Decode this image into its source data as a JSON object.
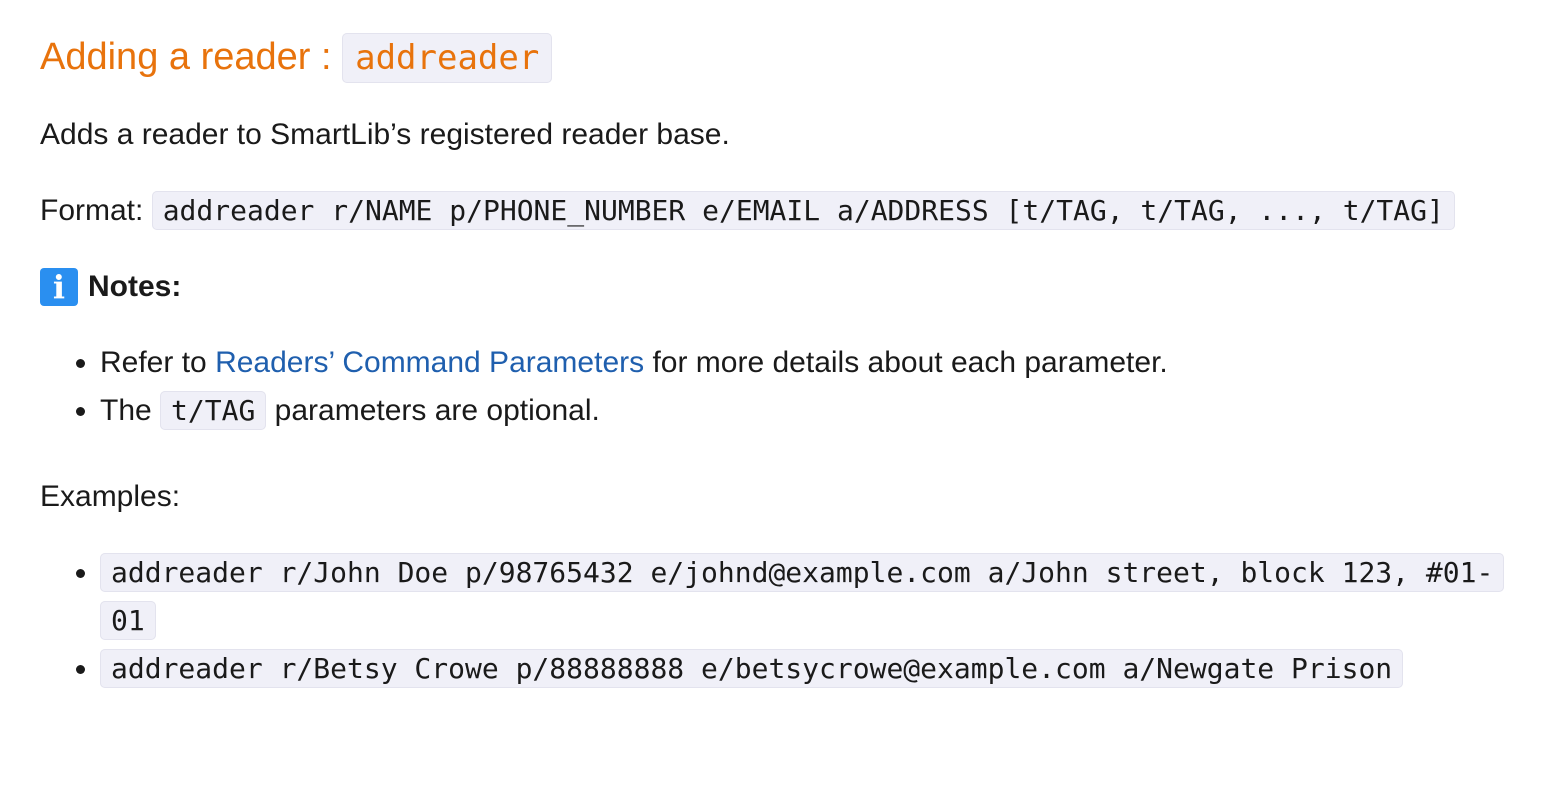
{
  "section": {
    "title_text": "Adding a reader : ",
    "title_code": "addreader"
  },
  "description": "Adds a reader to SmartLib’s registered reader base.",
  "format": {
    "label": "Format: ",
    "command": "addreader r/NAME p/PHONE_NUMBER e/EMAIL a/ADDRESS [t/TAG, t/TAG, ..., t/TAG]"
  },
  "notes": {
    "icon": "information-icon",
    "icon_glyph": "i",
    "title": "Notes:",
    "item1": {
      "prefix": "Refer to ",
      "link": "Readers’ Command Parameters",
      "suffix": " for more details about each parameter."
    },
    "item2": {
      "prefix": "The ",
      "code": "t/TAG",
      "suffix": " parameters are optional."
    }
  },
  "examples": {
    "title": "Examples:",
    "items": [
      "addreader r/John Doe p/98765432 e/johnd@example.com a/John street, block 123, #01-01",
      "addreader r/Betsy Crowe p/88888888 e/betsycrowe@example.com a/Newgate Prison"
    ]
  },
  "colors": {
    "heading": "#e8730c",
    "link": "#1f5fae",
    "code_bg": "#f0f0f8",
    "info_icon": "#2a8ff0"
  }
}
